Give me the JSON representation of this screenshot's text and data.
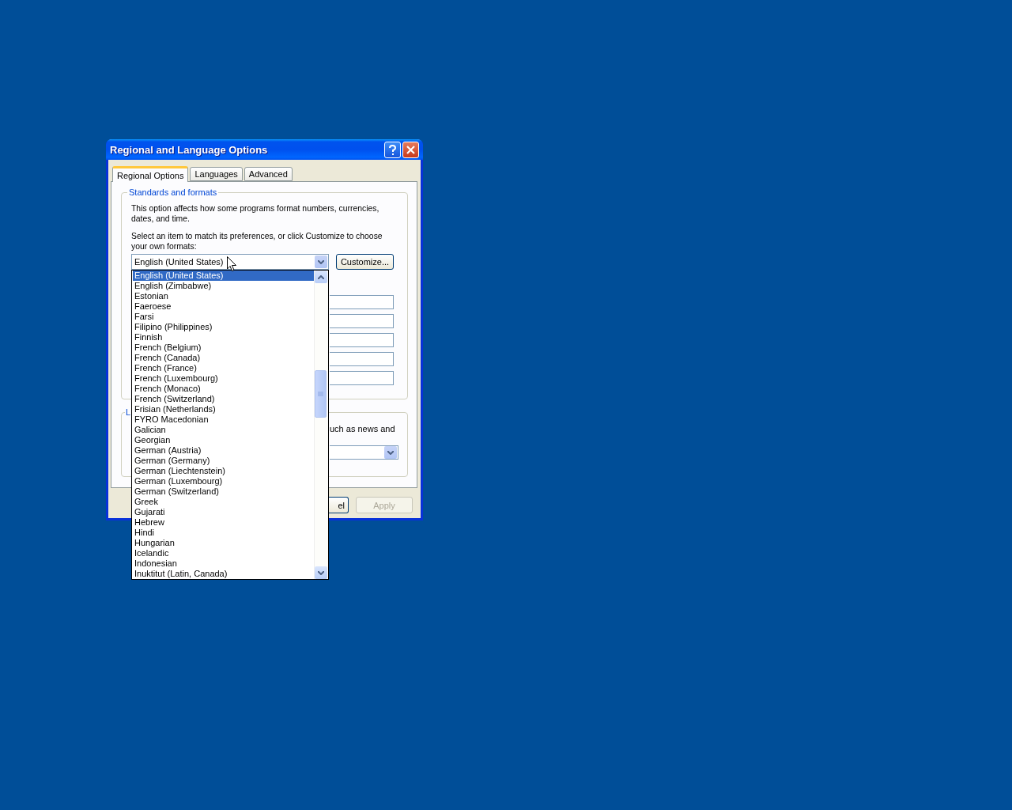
{
  "window": {
    "title": "Regional and Language Options"
  },
  "tabs": [
    {
      "label": "Regional Options",
      "selected": true
    },
    {
      "label": "Languages",
      "selected": false
    },
    {
      "label": "Advanced",
      "selected": false
    }
  ],
  "standards_group": {
    "title": "Standards and formats",
    "description": "This option affects how some programs format numbers, currencies, dates, and time.",
    "instruction": "Select an item to match its preferences, or click Customize to choose your own formats:",
    "combo": {
      "value": "English (United States)",
      "expanded": true
    },
    "customize_button": "Customize..."
  },
  "dropdown_list": {
    "items": [
      {
        "label": "English (United States)",
        "selected": true
      },
      {
        "label": "English (Zimbabwe)",
        "selected": false
      },
      {
        "label": "Estonian",
        "selected": false
      },
      {
        "label": "Faeroese",
        "selected": false
      },
      {
        "label": "Farsi",
        "selected": false
      },
      {
        "label": "Filipino (Philippines)",
        "selected": false
      },
      {
        "label": "Finnish",
        "selected": false
      },
      {
        "label": "French (Belgium)",
        "selected": false
      },
      {
        "label": "French (Canada)",
        "selected": false
      },
      {
        "label": "French (France)",
        "selected": false
      },
      {
        "label": "French (Luxembourg)",
        "selected": false
      },
      {
        "label": "French (Monaco)",
        "selected": false
      },
      {
        "label": "French (Switzerland)",
        "selected": false
      },
      {
        "label": "Frisian (Netherlands)",
        "selected": false
      },
      {
        "label": "FYRO Macedonian",
        "selected": false
      },
      {
        "label": "Galician",
        "selected": false
      },
      {
        "label": "Georgian",
        "selected": false
      },
      {
        "label": "German (Austria)",
        "selected": false
      },
      {
        "label": "German (Germany)",
        "selected": false
      },
      {
        "label": "German (Liechtenstein)",
        "selected": false
      },
      {
        "label": "German (Luxembourg)",
        "selected": false
      },
      {
        "label": "German (Switzerland)",
        "selected": false
      },
      {
        "label": "Greek",
        "selected": false
      },
      {
        "label": "Gujarati",
        "selected": false
      },
      {
        "label": "Hebrew",
        "selected": false
      },
      {
        "label": "Hindi",
        "selected": false
      },
      {
        "label": "Hungarian",
        "selected": false
      },
      {
        "label": "Icelandic",
        "selected": false
      },
      {
        "label": "Indonesian",
        "selected": false
      },
      {
        "label": "Inuktitut (Latin, Canada)",
        "selected": false
      }
    ]
  },
  "location_group": {
    "title": "L",
    "description": "uch as news and"
  },
  "buttons": [
    {
      "label": "el",
      "disabled": false
    },
    {
      "label": "Apply",
      "disabled": true
    }
  ]
}
